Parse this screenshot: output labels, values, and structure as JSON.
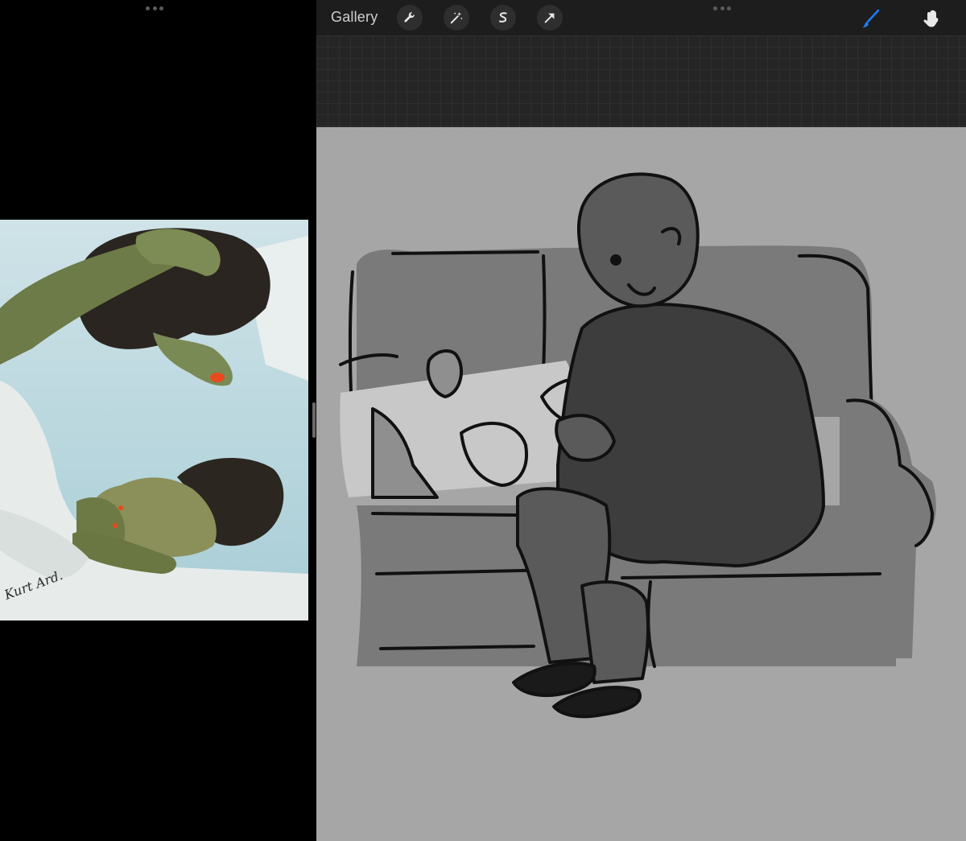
{
  "toolbar": {
    "gallery_label": "Gallery",
    "tools": [
      {
        "name": "actions",
        "icon": "wrench-icon"
      },
      {
        "name": "adjustments",
        "icon": "magic-wand-icon"
      },
      {
        "name": "selection",
        "icon": "selection-s-icon"
      },
      {
        "name": "transform",
        "icon": "arrow-cursor-icon"
      }
    ],
    "right_tools": [
      {
        "name": "brush",
        "icon": "brush-icon",
        "active": true
      },
      {
        "name": "smudge",
        "icon": "smudge-finger-icon",
        "active": false
      }
    ]
  },
  "reference": {
    "signature": "Kurt Ard."
  },
  "colors": {
    "toolbar_bg": "#1d1d1d",
    "canvas_bg": "#a6a6a6",
    "active_tool": "#1e7cf2",
    "icon": "#e8e8e8"
  }
}
